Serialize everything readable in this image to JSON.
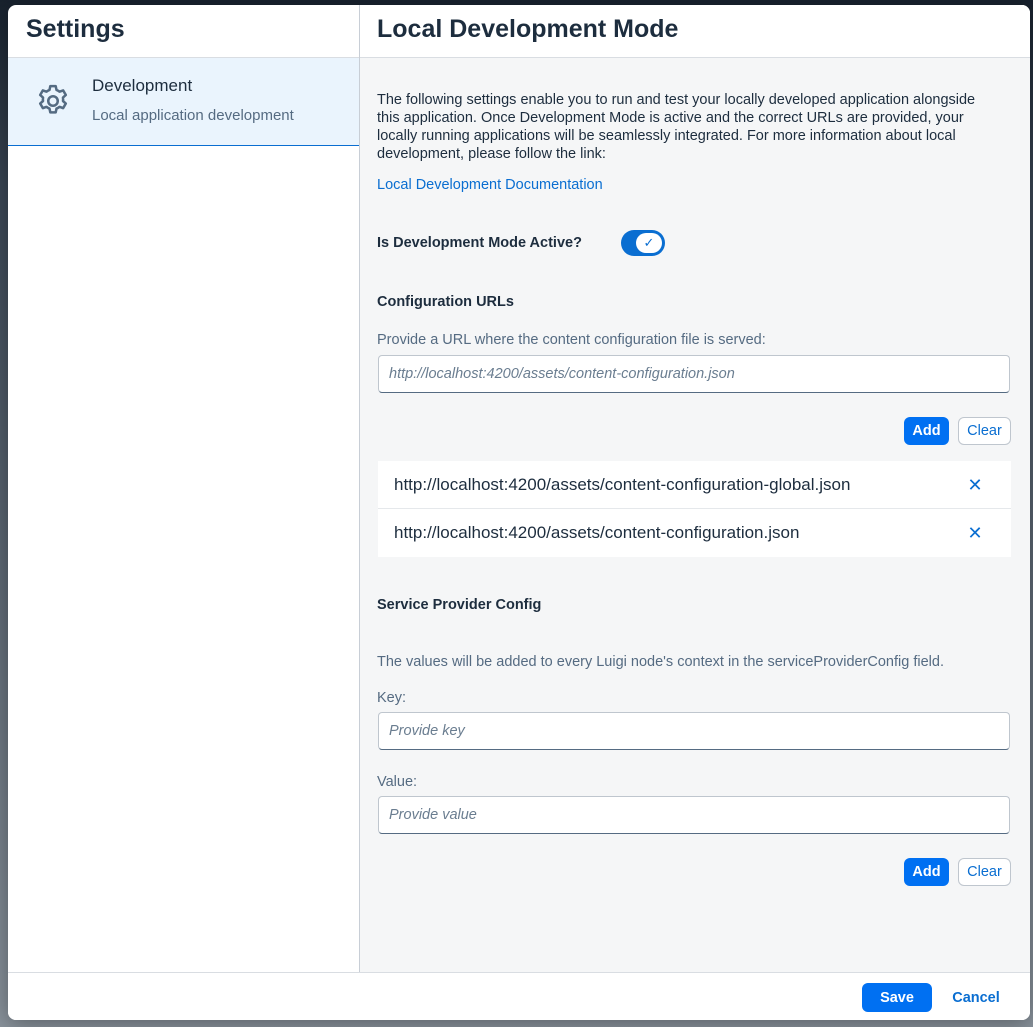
{
  "left_pane": {
    "title": "Settings",
    "items": [
      {
        "icon": "gear-icon",
        "title": "Development",
        "subtitle": "Local application development"
      }
    ]
  },
  "main": {
    "title": "Local Development Mode",
    "intro": "The following settings enable you to run and test your locally developed application alongside this application. Once Development Mode is active and the correct URLs are provided, your locally running applications will be seamlessly integrated. For more information about local development, please follow the link:",
    "doc_link": "Local Development Documentation",
    "toggle": {
      "label": "Is Development Mode Active?",
      "checked": true
    },
    "config_urls": {
      "title": "Configuration URLs",
      "field_label": "Provide a URL where the content configuration file is served:",
      "placeholder": "http://localhost:4200/assets/content-configuration.json",
      "value": "",
      "add_label": "Add",
      "clear_label": "Clear",
      "urls": [
        "http://localhost:4200/assets/content-configuration-global.json",
        "http://localhost:4200/assets/content-configuration.json"
      ]
    },
    "service_provider": {
      "title": "Service Provider Config",
      "description": "The values will be added to every Luigi node's context in the serviceProviderConfig field.",
      "key_label": "Key:",
      "key_placeholder": "Provide key",
      "value_label": "Value:",
      "value_placeholder": "Provide value",
      "add_label": "Add",
      "clear_label": "Clear"
    }
  },
  "footer": {
    "save_label": "Save",
    "cancel_label": "Cancel"
  },
  "colors": {
    "accent": "#0a6ed1",
    "primary_button": "#0070f2",
    "selected_nav": "#eaf4fd"
  }
}
